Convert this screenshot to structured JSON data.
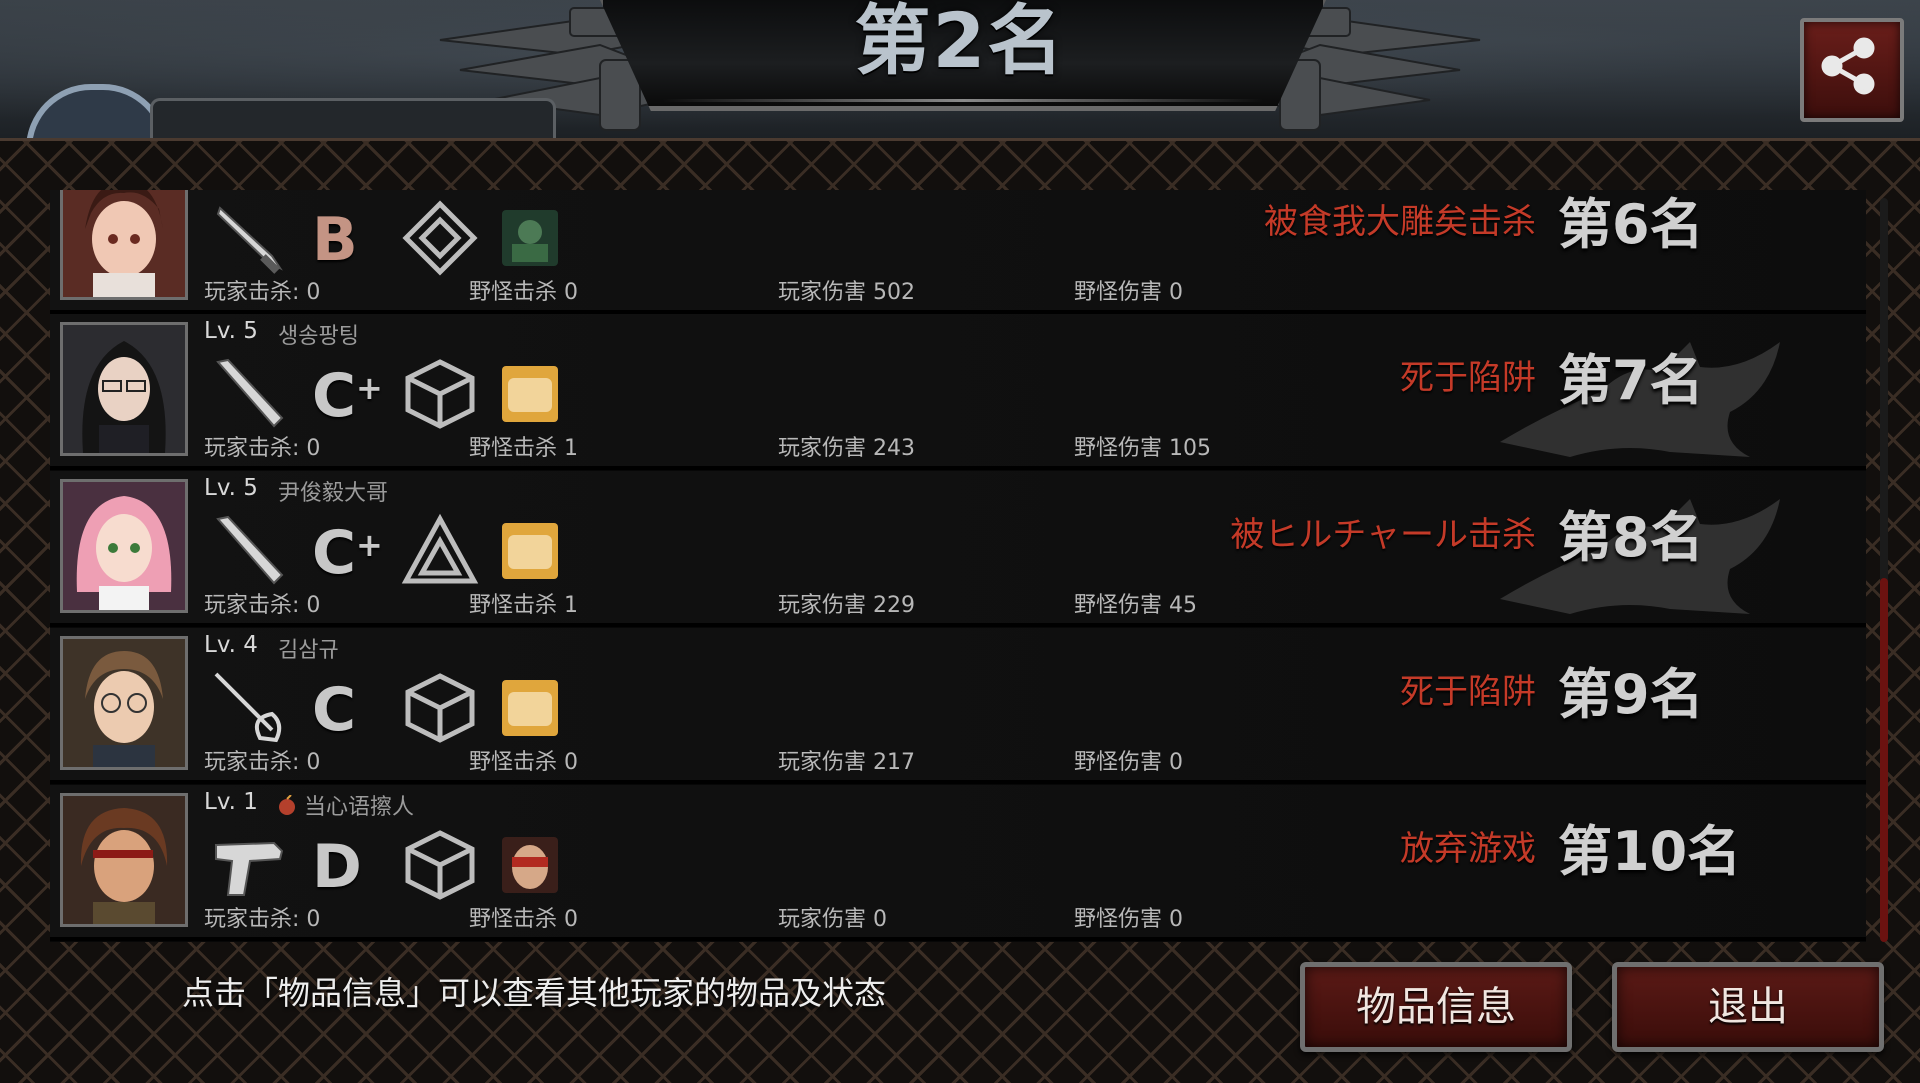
{
  "header": {
    "rank_title": "第2名"
  },
  "players": [
    {
      "level": "",
      "name": "",
      "portrait": "portrait-girl-red-dress",
      "weapon_icon": "knife-icon",
      "grade": "B",
      "grade_plus": "",
      "armor_icon": "armor-diamond-icon",
      "item_icon": "item-soldier-icon",
      "player_kills": "玩家击杀: 0",
      "monster_kills": "野怪击杀 0",
      "player_damage": "玩家伤害 502",
      "monster_damage": "野怪伤害 0",
      "death_cause": "被食我大雕矣击杀",
      "rank": "第6名"
    },
    {
      "level": "Lv. 5",
      "name": "생송팡팅",
      "portrait": "portrait-woman-glasses",
      "weapon_icon": "bat-icon",
      "grade": "C",
      "grade_plus": "+",
      "armor_icon": "armor-box-icon",
      "item_icon": "item-bread-icon",
      "player_kills": "玩家击杀: 0",
      "monster_kills": "野怪击杀 1",
      "player_damage": "玩家伤害 243",
      "monster_damage": "野怪伤害 105",
      "death_cause": "死于陷阱",
      "rank": "第7名"
    },
    {
      "level": "Lv. 5",
      "name": "尹俊毅大哥",
      "portrait": "portrait-girl-pink-hair",
      "weapon_icon": "bat-icon",
      "grade": "C",
      "grade_plus": "+",
      "armor_icon": "armor-triangle-icon",
      "item_icon": "item-bread-icon",
      "player_kills": "玩家击杀: 0",
      "monster_kills": "野怪击杀 1",
      "player_damage": "玩家伤害 229",
      "monster_damage": "野怪伤害 45",
      "death_cause": "被ヒルチャール击杀",
      "rank": "第8名"
    },
    {
      "level": "Lv. 4",
      "name": "김삼규",
      "portrait": "portrait-man-glasses",
      "weapon_icon": "rapier-icon",
      "grade": "C",
      "grade_plus": "",
      "armor_icon": "armor-box-icon",
      "item_icon": "item-bread-icon",
      "player_kills": "玩家击杀: 0",
      "monster_kills": "野怪击杀 0",
      "player_damage": "玩家伤害 217",
      "monster_damage": "野怪伤害 0",
      "death_cause": "死于陷阱",
      "rank": "第9名"
    },
    {
      "level": "Lv. 1",
      "name": "当心语擦人",
      "portrait": "portrait-man-brown-hair",
      "weapon_icon": "pistol-icon",
      "grade": "D",
      "grade_plus": "",
      "armor_icon": "armor-box-icon",
      "item_icon": "item-goggles-man-icon",
      "player_kills": "玩家击杀: 0",
      "monster_kills": "野怪击杀 0",
      "player_damage": "玩家伤害 0",
      "monster_damage": "野怪伤害 0",
      "death_cause": "放弃游戏",
      "rank": "第10名"
    }
  ],
  "footer": {
    "hint": "点击「物品信息」可以查看其他玩家的物品及状态",
    "item_info_button": "物品信息",
    "exit_button": "退出"
  },
  "colors": {
    "death_text": "#c43a28",
    "button_fill": "#5b1a16",
    "scroll_thumb": "#6b1210"
  }
}
